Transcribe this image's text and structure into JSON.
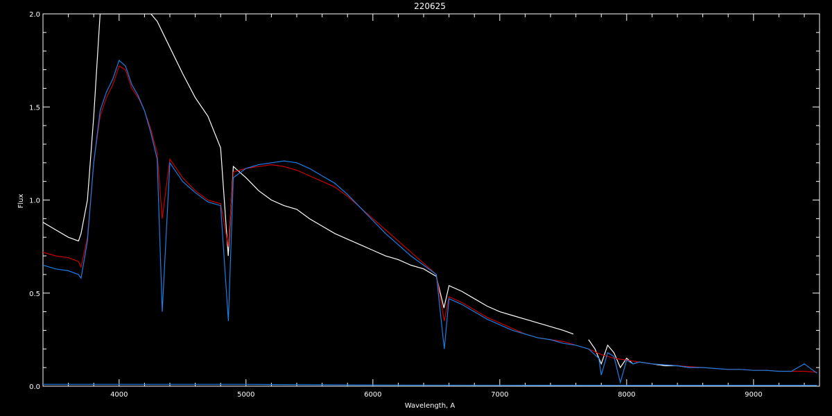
{
  "chart_data": {
    "type": "line",
    "title": "220625",
    "xlabel": "Wavelength, A",
    "ylabel": "Flux",
    "xlim": [
      3400,
      9520
    ],
    "ylim": [
      0.0,
      2.0
    ],
    "x_ticks": [
      4000,
      5000,
      6000,
      7000,
      8000,
      9000
    ],
    "x_tick_labels": [
      "4000",
      "5000",
      "6000",
      "7000",
      "8000",
      "9000"
    ],
    "y_ticks": [
      0.0,
      0.5,
      1.0,
      1.5,
      2.0
    ],
    "y_tick_labels": [
      "0.0",
      "0.5",
      "1.0",
      "1.5",
      "2.0"
    ],
    "grid": false,
    "background": "#000000",
    "series": [
      {
        "color": "#ffffff",
        "x": [
          3400,
          3500,
          3600,
          3680,
          3700,
          3750,
          3800,
          3850,
          3900,
          3950,
          4000,
          4050,
          4100,
          4150,
          4200,
          4250,
          4300,
          4400,
          4500,
          4600,
          4700,
          4800,
          4860,
          4900,
          5000,
          5100,
          5200,
          5300,
          5400,
          5500,
          5600,
          5700,
          5800,
          5900,
          6000,
          6100,
          6200,
          6300,
          6400,
          6500,
          6560,
          6600,
          6700,
          6800,
          6900,
          7000,
          7100,
          7200,
          7300,
          7400,
          7500,
          7580
        ],
        "y": [
          0.88,
          0.84,
          0.8,
          0.78,
          0.82,
          1.0,
          1.45,
          2.0,
          2.0,
          2.0,
          2.0,
          2.0,
          2.0,
          2.0,
          2.0,
          2.0,
          1.96,
          1.82,
          1.68,
          1.55,
          1.45,
          1.28,
          0.7,
          1.18,
          1.12,
          1.05,
          1.0,
          0.97,
          0.95,
          0.9,
          0.86,
          0.82,
          0.79,
          0.76,
          0.73,
          0.7,
          0.68,
          0.65,
          0.63,
          0.59,
          0.42,
          0.54,
          0.51,
          0.47,
          0.43,
          0.4,
          0.38,
          0.36,
          0.34,
          0.32,
          0.3,
          0.28
        ]
      },
      {
        "color": "#ffffff",
        "x": [
          7700,
          7750,
          7800,
          7850,
          7900,
          7950,
          8000,
          8050,
          8100,
          8200,
          8300,
          8400,
          8500
        ],
        "y": [
          0.25,
          0.2,
          0.12,
          0.22,
          0.18,
          0.1,
          0.15,
          0.12,
          0.13,
          0.12,
          0.11,
          0.11,
          0.1
        ]
      },
      {
        "color": "#cc0000",
        "x": [
          3400,
          3500,
          3600,
          3680,
          3700,
          3750,
          3800,
          3850,
          3900,
          3950,
          4000,
          4050,
          4100,
          4150,
          4200,
          4250,
          4300,
          4340,
          4400,
          4500,
          4600,
          4700,
          4800,
          4861,
          4900,
          5000,
          5100,
          5200,
          5300,
          5400,
          5500,
          5600,
          5700,
          5800,
          5900,
          6000,
          6100,
          6200,
          6300,
          6400,
          6500,
          6563,
          6600,
          6700,
          6800,
          6900,
          7000,
          7100,
          7200,
          7300,
          7400,
          7500,
          7600,
          7700,
          7800,
          7900,
          8000,
          8100,
          8200,
          8300,
          8400,
          8500,
          8600,
          8700,
          8800,
          8900,
          9000,
          9100,
          9200,
          9300,
          9400,
          9500
        ],
        "y": [
          0.72,
          0.7,
          0.69,
          0.67,
          0.64,
          0.8,
          1.2,
          1.45,
          1.55,
          1.62,
          1.72,
          1.7,
          1.6,
          1.55,
          1.48,
          1.38,
          1.25,
          0.9,
          1.22,
          1.12,
          1.05,
          1.0,
          0.98,
          0.75,
          1.15,
          1.17,
          1.18,
          1.19,
          1.18,
          1.16,
          1.13,
          1.1,
          1.07,
          1.02,
          0.96,
          0.9,
          0.84,
          0.78,
          0.72,
          0.66,
          0.6,
          0.35,
          0.48,
          0.45,
          0.41,
          0.37,
          0.34,
          0.31,
          0.28,
          0.26,
          0.25,
          0.24,
          0.22,
          0.2,
          0.17,
          0.15,
          0.14,
          0.13,
          0.12,
          0.115,
          0.11,
          0.105,
          0.1,
          0.095,
          0.09,
          0.09,
          0.085,
          0.085,
          0.08,
          0.08,
          0.08,
          0.075
        ]
      },
      {
        "color": "#1a7fe8",
        "x": [
          3400,
          3500,
          3600,
          3680,
          3700,
          3750,
          3800,
          3850,
          3900,
          3950,
          4000,
          4050,
          4100,
          4150,
          4200,
          4250,
          4300,
          4340,
          4400,
          4500,
          4600,
          4700,
          4800,
          4861,
          4900,
          5000,
          5100,
          5200,
          5300,
          5400,
          5500,
          5600,
          5700,
          5800,
          5900,
          6000,
          6100,
          6200,
          6300,
          6400,
          6500,
          6563,
          6600,
          6700,
          6800,
          6900,
          7000,
          7100,
          7200,
          7300,
          7400,
          7500,
          7600,
          7700,
          7780,
          7800,
          7850,
          7900,
          7950,
          8000,
          8050,
          8100,
          8200,
          8300,
          8400,
          8500,
          8600,
          8700,
          8800,
          8900,
          9000,
          9100,
          9200,
          9300,
          9400,
          9500
        ],
        "y": [
          0.65,
          0.63,
          0.62,
          0.6,
          0.58,
          0.78,
          1.2,
          1.48,
          1.58,
          1.65,
          1.75,
          1.72,
          1.62,
          1.56,
          1.48,
          1.36,
          1.22,
          0.4,
          1.2,
          1.1,
          1.04,
          0.99,
          0.97,
          0.35,
          1.12,
          1.17,
          1.19,
          1.2,
          1.21,
          1.2,
          1.17,
          1.13,
          1.09,
          1.03,
          0.96,
          0.89,
          0.82,
          0.76,
          0.7,
          0.65,
          0.6,
          0.2,
          0.47,
          0.44,
          0.4,
          0.36,
          0.33,
          0.3,
          0.28,
          0.26,
          0.25,
          0.23,
          0.22,
          0.2,
          0.15,
          0.06,
          0.18,
          0.16,
          0.02,
          0.14,
          0.12,
          0.13,
          0.12,
          0.115,
          0.11,
          0.1,
          0.1,
          0.095,
          0.09,
          0.09,
          0.085,
          0.085,
          0.08,
          0.08,
          0.12,
          0.07
        ]
      },
      {
        "color": "#1a7fe8",
        "x": [
          3400,
          4000,
          5000,
          5500,
          6000,
          7000,
          8000,
          9000,
          9500
        ],
        "y": [
          0.01,
          0.01,
          0.01,
          0.008,
          0.006,
          0.005,
          0.004,
          0.004,
          0.004
        ]
      }
    ]
  }
}
